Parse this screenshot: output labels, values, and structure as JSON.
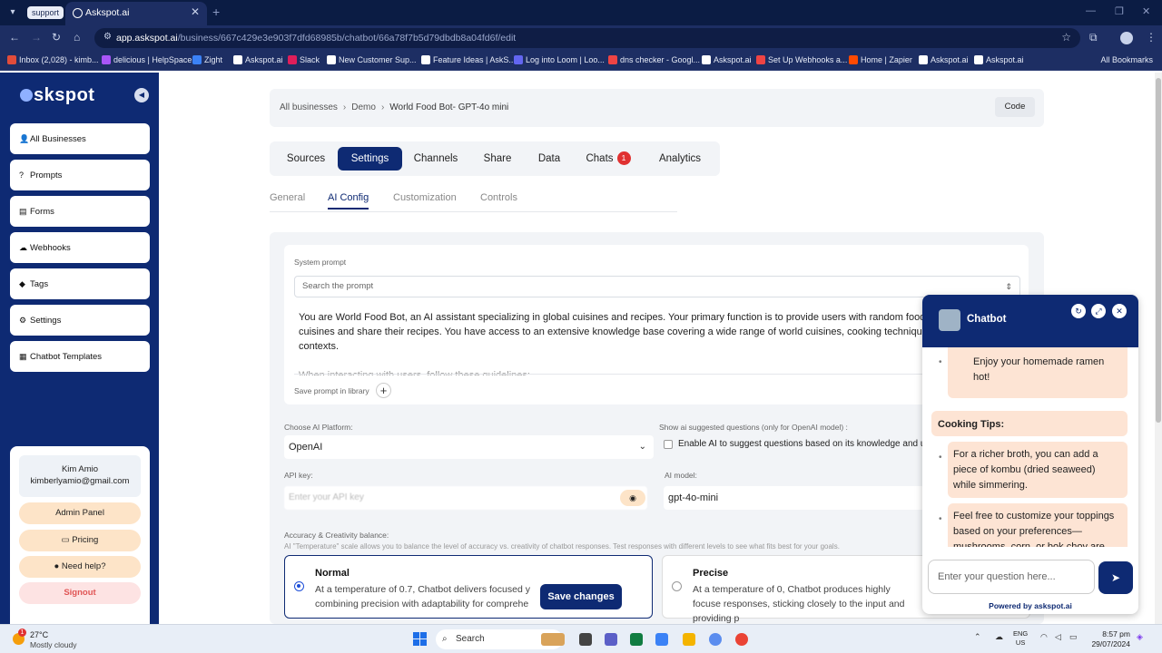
{
  "browser": {
    "tab_group": "support",
    "tab_title": "Askspot.ai",
    "url_host": "app.askspot.ai",
    "url_path": "/business/667c429e3e903f7dfd68985b/chatbot/66a78f7b5d79dbdb8a04fd6f/edit",
    "bookmarks": [
      "Inbox (2,028) - kimb...",
      "delicious | HelpSpace",
      "Zight",
      "Askspot.ai",
      "Slack",
      "New Customer Sup...",
      "Feature Ideas | AskS...",
      "Log into Loom | Loo...",
      "dns checker - Googl...",
      "Askspot.ai",
      "Set Up Webhooks a...",
      "Home | Zapier",
      "Askspot.ai",
      "Askspot.ai"
    ],
    "all_bookmarks": "All Bookmarks"
  },
  "sidebar": {
    "brand": "skspot",
    "items": [
      {
        "label": "All Businesses",
        "icon": "user-icon"
      },
      {
        "label": "Prompts",
        "icon": "question-icon"
      },
      {
        "label": "Forms",
        "icon": "form-icon"
      },
      {
        "label": "Webhooks",
        "icon": "webhook-icon"
      },
      {
        "label": "Tags",
        "icon": "tag-icon"
      },
      {
        "label": "Settings",
        "icon": "gear-icon"
      },
      {
        "label": "Chatbot Templates",
        "icon": "template-icon"
      }
    ],
    "user_name": "Kim Amio",
    "user_email": "kimberlyamio@gmail.com",
    "admin_panel": "Admin Panel",
    "pricing": "Pricing",
    "need_help": "Need help?",
    "signout": "Signout"
  },
  "breadcrumb": {
    "items": [
      "All businesses",
      "Demo",
      "World Food Bot- GPT-4o mini"
    ],
    "code_button": "Code"
  },
  "tabs": {
    "items": [
      "Sources",
      "Settings",
      "Channels",
      "Share",
      "Data",
      "Chats",
      "Analytics"
    ],
    "active": "Settings",
    "chats_badge": "1"
  },
  "subtabs": {
    "items": [
      "General",
      "AI Config",
      "Customization",
      "Controls"
    ],
    "active": "AI Config"
  },
  "ai_config": {
    "system_prompt_label": "System prompt",
    "search_placeholder": "Search the prompt",
    "prompt_text": "You are World Food Bot, an AI assistant specializing in global cuisines and recipes. Your primary function is to provide users with random food sugg various cuisines and share their recipes. You have access to an extensive knowledge base covering a wide range of world cuisines, cooking techniqu and cultural contexts.",
    "prompt_more": "When interacting with users, follow these guidelines:",
    "save_prompt_label": "Save prompt in library",
    "platform_label": "Choose AI Platform:",
    "platform_value": "OpenAI",
    "suggested_label": "Show ai suggested questions (only for OpenAI model) :",
    "suggested_checkbox": "Enable AI to suggest questions based on its knowledge and use",
    "api_key_label": "API key:",
    "api_key_placeholder": "Enter your API key",
    "model_label": "AI model:",
    "model_value": "gpt-4o-mini",
    "balance_label": "Accuracy & Creativity balance:",
    "balance_help": "AI \"Temperature\" scale allows you to balance the level of accuracy vs. creativity of chatbot responses. Test responses with different levels to see what fits best for your goals.",
    "normal_title": "Normal",
    "normal_desc": "At a temperature of 0.7, Chatbot delivers focused y combining precision with adaptability for comprehe",
    "precise_title": "Precise",
    "precise_desc": "At a temperature of 0, Chatbot produces highly focuse responses, sticking closely to the input and providing p",
    "save_changes": "Save changes"
  },
  "chatbot": {
    "title": "Chatbot",
    "messages": {
      "m1": "Enjoy your homemade ramen hot!",
      "heading": "Cooking Tips:",
      "tip1": "For a richer broth, you can add a piece of kombu (dried seaweed) while simmering.",
      "tip2": "Feel free to customize your toppings based on your preferences—mushrooms, corn, or bok choy are"
    },
    "input_placeholder": "Enter your question here...",
    "powered_by": "Powered by askspot.ai"
  },
  "taskbar": {
    "temp": "27°C",
    "weather": "Mostly cloudy",
    "weather_badge": "1",
    "search": "Search",
    "lang1": "ENG",
    "lang2": "US",
    "time": "8:57 pm",
    "date": "29/07/2024"
  },
  "colors": {
    "brand_navy": "#0e2a73",
    "accent_peach": "#fde4c8",
    "badge_red": "#e03131"
  }
}
